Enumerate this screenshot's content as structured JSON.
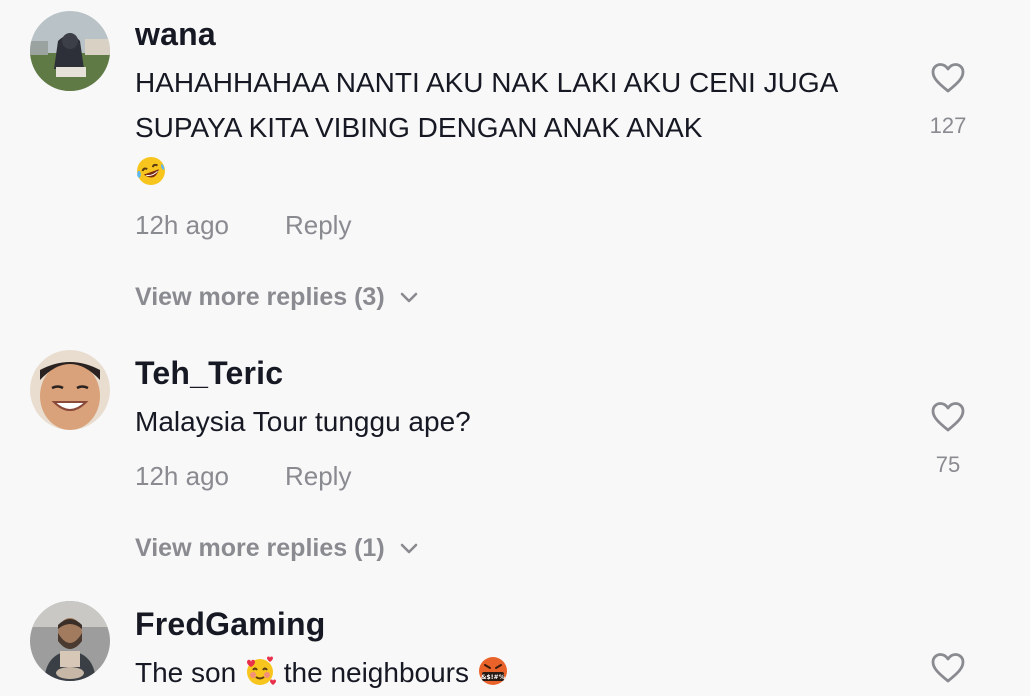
{
  "comments": [
    {
      "username": "wana",
      "text": "HAHAHHAHAA NANTI AKU NAK LAKI AKU CENI JUGA SUPAYA KITA VIBING DENGAN ANAK ANAK",
      "time": "12h ago",
      "reply": "Reply",
      "view_more": "View more replies (3)",
      "likes": "127"
    },
    {
      "username": "Teh_Teric",
      "text": "Malaysia Tour tunggu ape?",
      "time": "12h ago",
      "reply": "Reply",
      "view_more": "View more replies (1)",
      "likes": "75"
    },
    {
      "username": "FredGaming",
      "text_part1": "The son",
      "text_part2": "the neighbours",
      "emoji_angry_label": "&$!#%"
    }
  ],
  "icons": {
    "heart": "heart-outline-icon",
    "chevron": "chevron-down-icon"
  },
  "colors": {
    "background": "#f8f8f8",
    "text_primary": "#161823",
    "text_secondary": "#8a8b91"
  }
}
